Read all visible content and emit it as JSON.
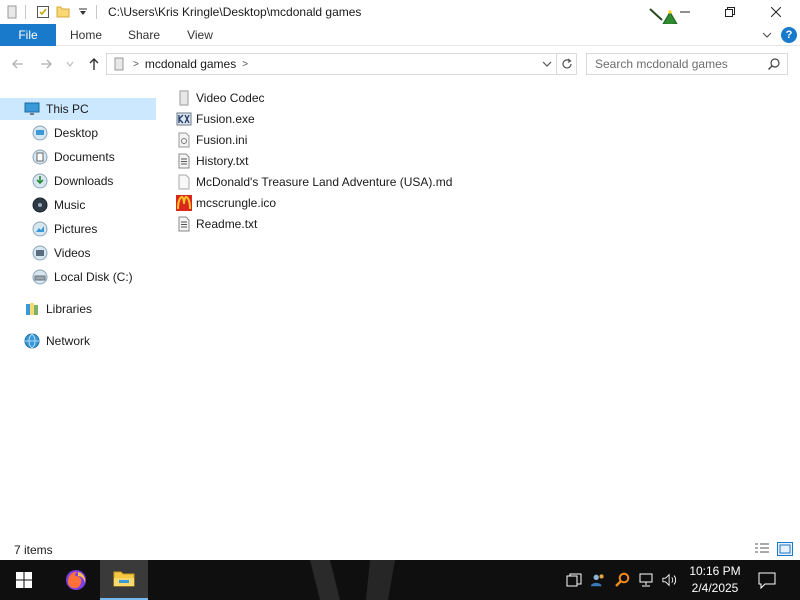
{
  "window": {
    "title": "C:\\Users\\Kris Kringle\\Desktop\\mcdonald games"
  },
  "ribbon": {
    "tabs": [
      {
        "label": "File"
      },
      {
        "label": "Home"
      },
      {
        "label": "Share"
      },
      {
        "label": "View"
      }
    ],
    "help_label": "?"
  },
  "address": {
    "path_segment": "mcdonald games",
    "search_placeholder": "Search mcdonald games"
  },
  "navigation_pane": {
    "items": [
      {
        "label": "This PC",
        "icon": "this-pc-icon",
        "selected": true
      },
      {
        "label": "Desktop",
        "icon": "desktop-icon"
      },
      {
        "label": "Documents",
        "icon": "documents-icon"
      },
      {
        "label": "Downloads",
        "icon": "downloads-icon"
      },
      {
        "label": "Music",
        "icon": "music-icon"
      },
      {
        "label": "Pictures",
        "icon": "pictures-icon"
      },
      {
        "label": "Videos",
        "icon": "videos-icon"
      },
      {
        "label": "Local Disk (C:)",
        "icon": "local-disk-icon"
      },
      {
        "label": "Libraries",
        "icon": "libraries-icon"
      },
      {
        "label": "Network",
        "icon": "network-icon"
      }
    ]
  },
  "files": [
    {
      "name": "Video Codec",
      "icon": "folder-icon"
    },
    {
      "name": "Fusion.exe",
      "icon": "fusion-exe-icon"
    },
    {
      "name": "Fusion.ini",
      "icon": "ini-file-icon"
    },
    {
      "name": "History.txt",
      "icon": "text-file-icon"
    },
    {
      "name": "McDonald's Treasure Land Adventure (USA).md",
      "icon": "md-file-icon"
    },
    {
      "name": "mcscrungle.ico",
      "icon": "mcdonalds-logo-icon"
    },
    {
      "name": "Readme.txt",
      "icon": "text-file-icon"
    }
  ],
  "status": {
    "item_count": "7 items"
  },
  "taskbar": {
    "time": "10:16 PM",
    "date": "2/4/2025"
  },
  "colors": {
    "accent": "#1979ca",
    "selection": "#cce8ff",
    "taskbar": "#0f0f0f",
    "mcdonalds_red": "#da291c",
    "mcdonalds_yellow": "#ffc72c"
  }
}
